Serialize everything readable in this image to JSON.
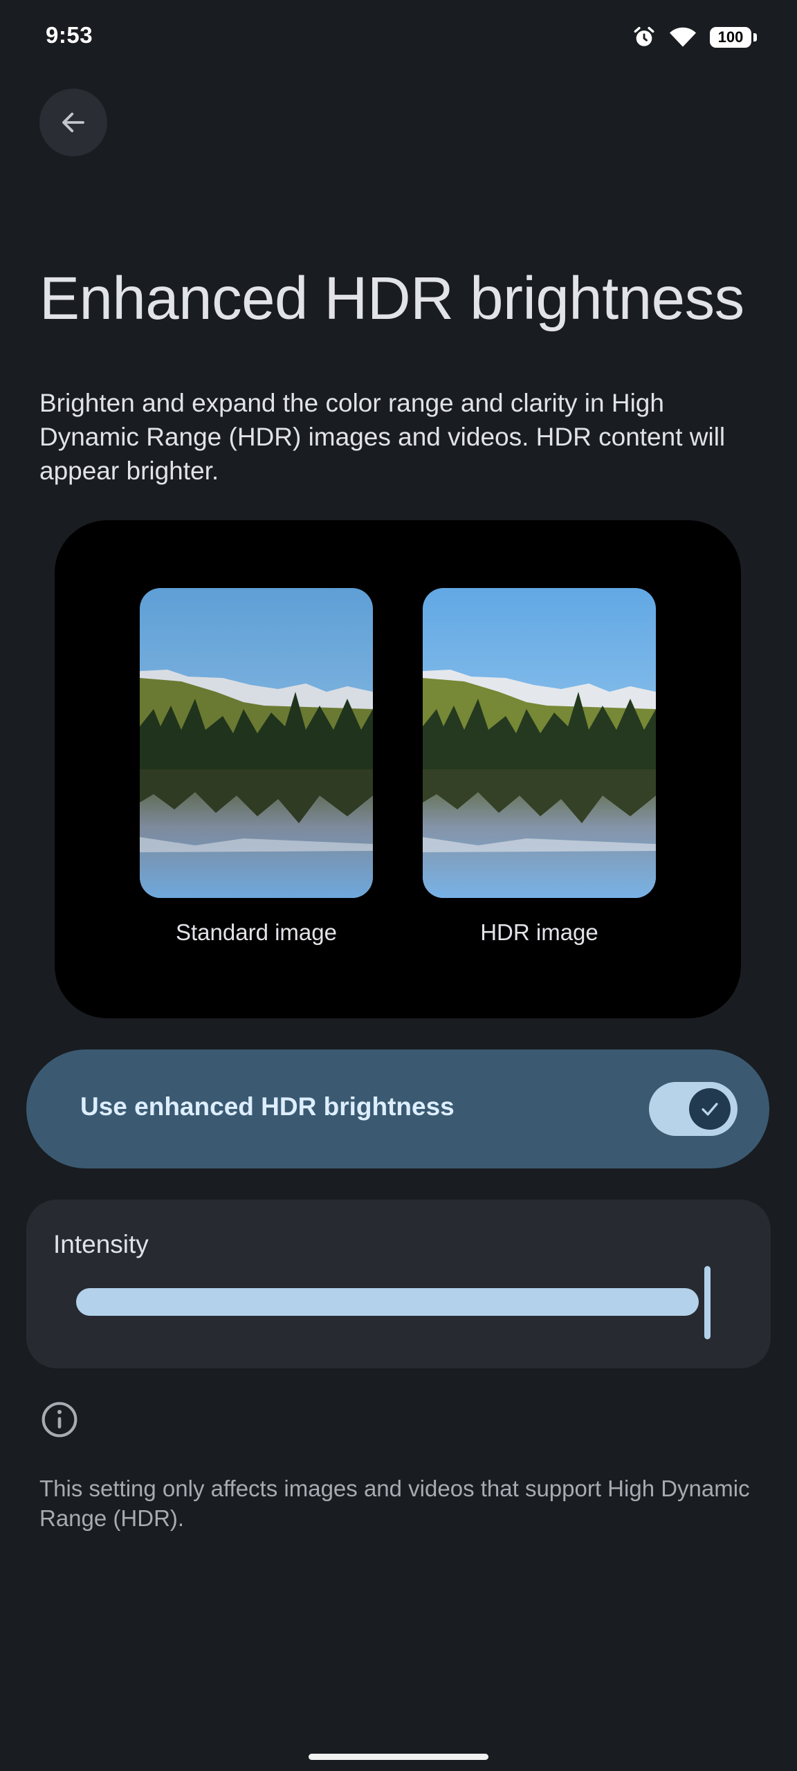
{
  "status_bar": {
    "time": "9:53",
    "battery": "100",
    "icons": [
      "alarm-icon",
      "wifi-icon",
      "battery-icon"
    ]
  },
  "header": {
    "back_icon": "arrow-left-icon",
    "title": "Enhanced HDR brightness"
  },
  "description": "Brighten and expand the color range and clarity in High Dynamic Range (HDR) images and videos. HDR content will appear brighter.",
  "preview": {
    "standard_label": "Standard image",
    "hdr_label": "HDR image"
  },
  "toggle": {
    "label": "Use enhanced HDR brightness",
    "checked": true
  },
  "intensity": {
    "label": "Intensity",
    "value_percent": 100
  },
  "info": {
    "icon": "info-icon",
    "note": "This setting only affects images and videos that support High Dynamic Range (HDR)."
  },
  "colors": {
    "background": "#191c20",
    "toggle_row": "#3b5a72",
    "accent": "#b3d1ea",
    "card": "#272a31"
  }
}
